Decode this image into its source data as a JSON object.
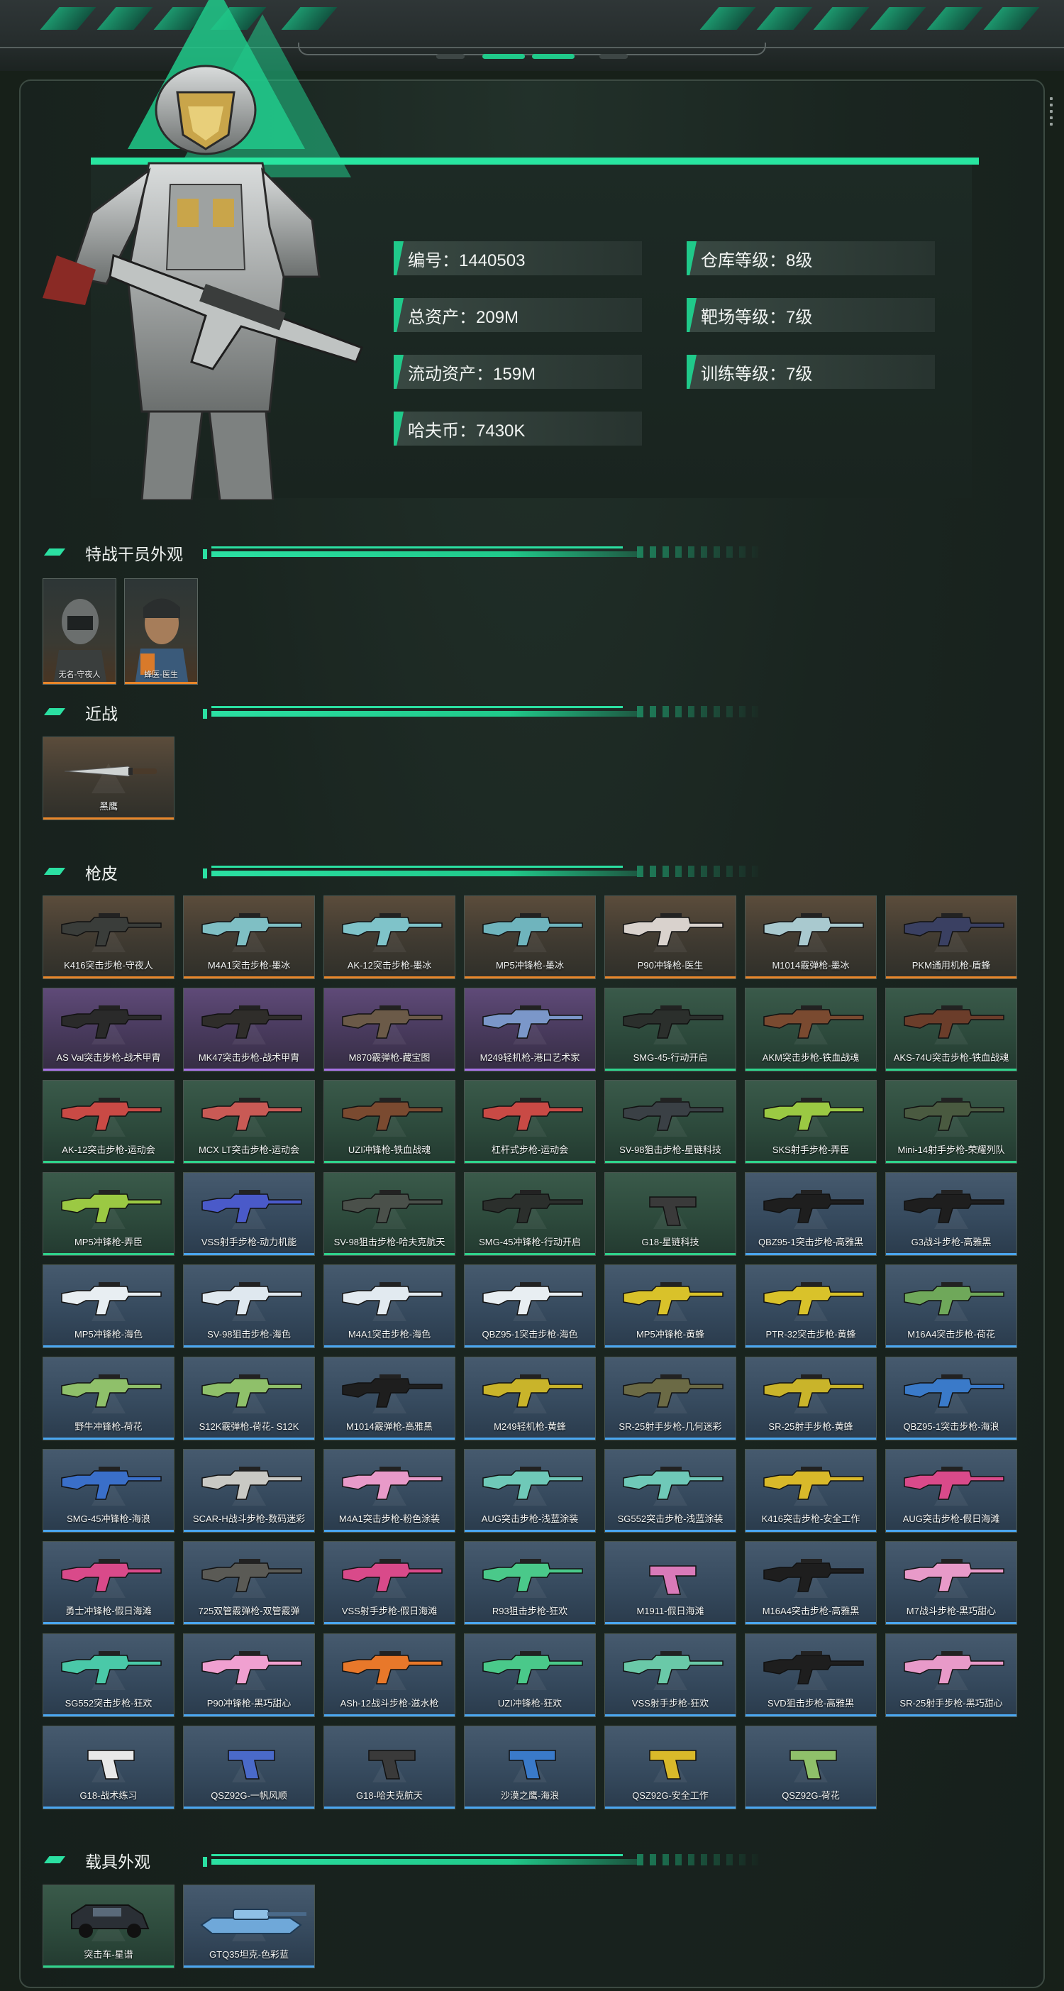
{
  "stats": [
    {
      "key": "id",
      "label": "编号：1440503"
    },
    {
      "key": "warehouse",
      "label": "仓库等级：8级"
    },
    {
      "key": "assets",
      "label": "总资产：209M"
    },
    {
      "key": "range",
      "label": "靶场等级：7级"
    },
    {
      "key": "liquid",
      "label": "流动资产：159M"
    },
    {
      "key": "training",
      "label": "训练等级：7级"
    },
    {
      "key": "hafcoin",
      "label": "哈夫币：7430K"
    }
  ],
  "sections": {
    "operators": "特战干员外观",
    "melee": "近战",
    "skins": "枪皮",
    "vehicles": "载具外观"
  },
  "operators": [
    {
      "label": "无名-守夜人"
    },
    {
      "label": "蜂医-医生"
    }
  ],
  "melee": [
    {
      "label": "黑鹰",
      "rarity": "orange"
    }
  ],
  "skins": [
    {
      "label": "K416突击步枪-守夜人",
      "rarity": "orange",
      "color": "#3a3d3a"
    },
    {
      "label": "M4A1突击步枪-墨冰",
      "rarity": "orange",
      "color": "#7fbfc4"
    },
    {
      "label": "AK-12突击步枪-墨冰",
      "rarity": "orange",
      "color": "#7fc3c9"
    },
    {
      "label": "MP5冲锋枪-墨冰",
      "rarity": "orange",
      "color": "#6fb4bd"
    },
    {
      "label": "P90冲锋枪-医生",
      "rarity": "orange",
      "color": "#d9d2cd"
    },
    {
      "label": "M1014霰弹枪-墨冰",
      "rarity": "orange",
      "color": "#a9c9cf"
    },
    {
      "label": "PKM通用机枪-盾蜂",
      "rarity": "orange",
      "color": "#3a4062"
    },
    {
      "label": "AS Val突击步枪-战术甲胄",
      "rarity": "purple",
      "color": "#2a2a2a"
    },
    {
      "label": "MK47突击步枪-战术甲胄",
      "rarity": "purple",
      "color": "#2f2d2a"
    },
    {
      "label": "M870霰弹枪-藏宝图",
      "rarity": "purple",
      "color": "#6b5a48"
    },
    {
      "label": "M249轻机枪-港口艺术家",
      "rarity": "purple",
      "color": "#7b97c9"
    },
    {
      "label": "SMG-45-行动开启",
      "rarity": "green",
      "color": "#2b2f2c"
    },
    {
      "label": "AKM突击步枪-铁血战魂",
      "rarity": "green",
      "color": "#7a4a30"
    },
    {
      "label": "AKS-74U突击步枪-铁血战魂",
      "rarity": "green",
      "color": "#6b3d2a"
    },
    {
      "label": "AK-12突击步枪-运动会",
      "rarity": "green",
      "color": "#c94a45"
    },
    {
      "label": "MCX LT突击步枪-运动会",
      "rarity": "green",
      "color": "#c95a55"
    },
    {
      "label": "UZI冲锋枪-铁血战魂",
      "rarity": "green",
      "color": "#7a4a30"
    },
    {
      "label": "杠杆式步枪-运动会",
      "rarity": "green",
      "color": "#c94a45"
    },
    {
      "label": "SV-98狙击步枪-星链科技",
      "rarity": "green",
      "color": "#3a4045"
    },
    {
      "label": "SKS射手步枪-弄臣",
      "rarity": "green",
      "color": "#9bc943"
    },
    {
      "label": "Mini-14射手步枪-荣耀列队",
      "rarity": "green",
      "color": "#4a5a40"
    },
    {
      "label": "MP5冲锋枪-弄臣",
      "rarity": "green",
      "color": "#9bc943"
    },
    {
      "label": "VSS射手步枪-动力机能",
      "rarity": "blue",
      "color": "#4a5ac9"
    },
    {
      "label": "SV-98狙击步枪-哈夫克航天",
      "rarity": "green",
      "color": "#4a504a"
    },
    {
      "label": "SMG-45冲锋枪-行动开启",
      "rarity": "green",
      "color": "#2b2f2c"
    },
    {
      "label": "G18-星链科技",
      "rarity": "green",
      "color": "#3a3a3a"
    },
    {
      "label": "QBZ95-1突击步枪-高雅黑",
      "rarity": "blue",
      "color": "#1e1e1e"
    },
    {
      "label": "G3战斗步枪-高雅黑",
      "rarity": "blue",
      "color": "#1e1e1e"
    },
    {
      "label": "MP5冲锋枪-海色",
      "rarity": "blue",
      "color": "#e8eef2"
    },
    {
      "label": "SV-98狙击步枪-海色",
      "rarity": "blue",
      "color": "#dfe8ef"
    },
    {
      "label": "M4A1突击步枪-海色",
      "rarity": "blue",
      "color": "#e2eaf0"
    },
    {
      "label": "QBZ95-1突击步枪-海色",
      "rarity": "blue",
      "color": "#e8eef2"
    },
    {
      "label": "MP5冲锋枪-黄蜂",
      "rarity": "blue",
      "color": "#d9c22a"
    },
    {
      "label": "PTR-32突击步枪-黄蜂",
      "rarity": "blue",
      "color": "#d9c22a"
    },
    {
      "label": "M16A4突击步枪-荷花",
      "rarity": "blue",
      "color": "#6fa85a"
    },
    {
      "label": "野牛冲锋枪-荷花",
      "rarity": "blue",
      "color": "#8fc06a"
    },
    {
      "label": "S12K霰弹枪-荷花- S12K",
      "rarity": "blue",
      "color": "#8fc06a"
    },
    {
      "label": "M1014霰弹枪-高雅黑",
      "rarity": "blue",
      "color": "#1e1e1e"
    },
    {
      "label": "M249轻机枪-黄蜂",
      "rarity": "blue",
      "color": "#c9b42a"
    },
    {
      "label": "SR-25射手步枪-几何迷彩",
      "rarity": "blue",
      "color": "#6b6a45"
    },
    {
      "label": "SR-25射手步枪-黄蜂",
      "rarity": "blue",
      "color": "#c9b42a"
    },
    {
      "label": "QBZ95-1突击步枪-海浪",
      "rarity": "blue",
      "color": "#3a7ac9"
    },
    {
      "label": "SMG-45冲锋枪-海浪",
      "rarity": "blue",
      "color": "#3a6fc9"
    },
    {
      "label": "SCAR-H战斗步枪-数码迷彩",
      "rarity": "blue",
      "color": "#c9c9c4"
    },
    {
      "label": "M4A1突击步枪-粉色涂装",
      "rarity": "blue",
      "color": "#e89ac9"
    },
    {
      "label": "AUG突击步枪-浅蓝涂装",
      "rarity": "blue",
      "color": "#6fc9b8"
    },
    {
      "label": "SG552突击步枪-浅蓝涂装",
      "rarity": "blue",
      "color": "#6fc9b8"
    },
    {
      "label": "K416突击步枪-安全工作",
      "rarity": "blue",
      "color": "#d9b92a"
    },
    {
      "label": "AUG突击步枪-假日海滩",
      "rarity": "blue",
      "color": "#d94a8a"
    },
    {
      "label": "勇士冲锋枪-假日海滩",
      "rarity": "blue",
      "color": "#d94a8a"
    },
    {
      "label": "725双管霰弹枪-双管霰弹",
      "rarity": "blue",
      "color": "#5a5a55"
    },
    {
      "label": "VSS射手步枪-假日海滩",
      "rarity": "blue",
      "color": "#d94a8a"
    },
    {
      "label": "R93狙击步枪-狂欢",
      "rarity": "blue",
      "color": "#4ac98a"
    },
    {
      "label": "M1911-假日海滩",
      "rarity": "blue",
      "color": "#d97ab9"
    },
    {
      "label": "M16A4突击步枪-高雅黑",
      "rarity": "blue",
      "color": "#1e1e1e"
    },
    {
      "label": "M7战斗步枪-黑巧甜心",
      "rarity": "blue",
      "color": "#e89ac9"
    },
    {
      "label": "SG552突击步枪-狂欢",
      "rarity": "blue",
      "color": "#4ac9a8"
    },
    {
      "label": "P90冲锋枪-黑巧甜心",
      "rarity": "blue",
      "color": "#f0a0d0"
    },
    {
      "label": "ASh-12战斗步枪-滋水枪",
      "rarity": "blue",
      "color": "#e8782a"
    },
    {
      "label": "UZI冲锋枪-狂欢",
      "rarity": "blue",
      "color": "#4ac98a"
    },
    {
      "label": "VSS射手步枪-狂欢",
      "rarity": "blue",
      "color": "#6ac9a8"
    },
    {
      "label": "SVD狙击步枪-高雅黑",
      "rarity": "blue",
      "color": "#1e1e1e"
    },
    {
      "label": "SR-25射手步枪-黑巧甜心",
      "rarity": "blue",
      "color": "#e89ac9"
    },
    {
      "label": "G18-战术练习",
      "rarity": "blue",
      "color": "#e8e8e8"
    },
    {
      "label": "QSZ92G-一帆风顺",
      "rarity": "blue",
      "color": "#4a6ac9"
    },
    {
      "label": "G18-哈夫克航天",
      "rarity": "blue",
      "color": "#3a3a3a"
    },
    {
      "label": "沙漠之鹰-海浪",
      "rarity": "blue",
      "color": "#3a7ac9"
    },
    {
      "label": "QSZ92G-安全工作",
      "rarity": "blue",
      "color": "#d9b92a"
    },
    {
      "label": "QSZ92G-荷花",
      "rarity": "blue",
      "color": "#8fc06a"
    }
  ],
  "vehicles": [
    {
      "label": "突击车-星谱",
      "rarity": "green",
      "color": "#2a2f35"
    },
    {
      "label": "GTQ35坦克-色彩蓝",
      "rarity": "blue",
      "color": "#6fa8d9"
    }
  ]
}
